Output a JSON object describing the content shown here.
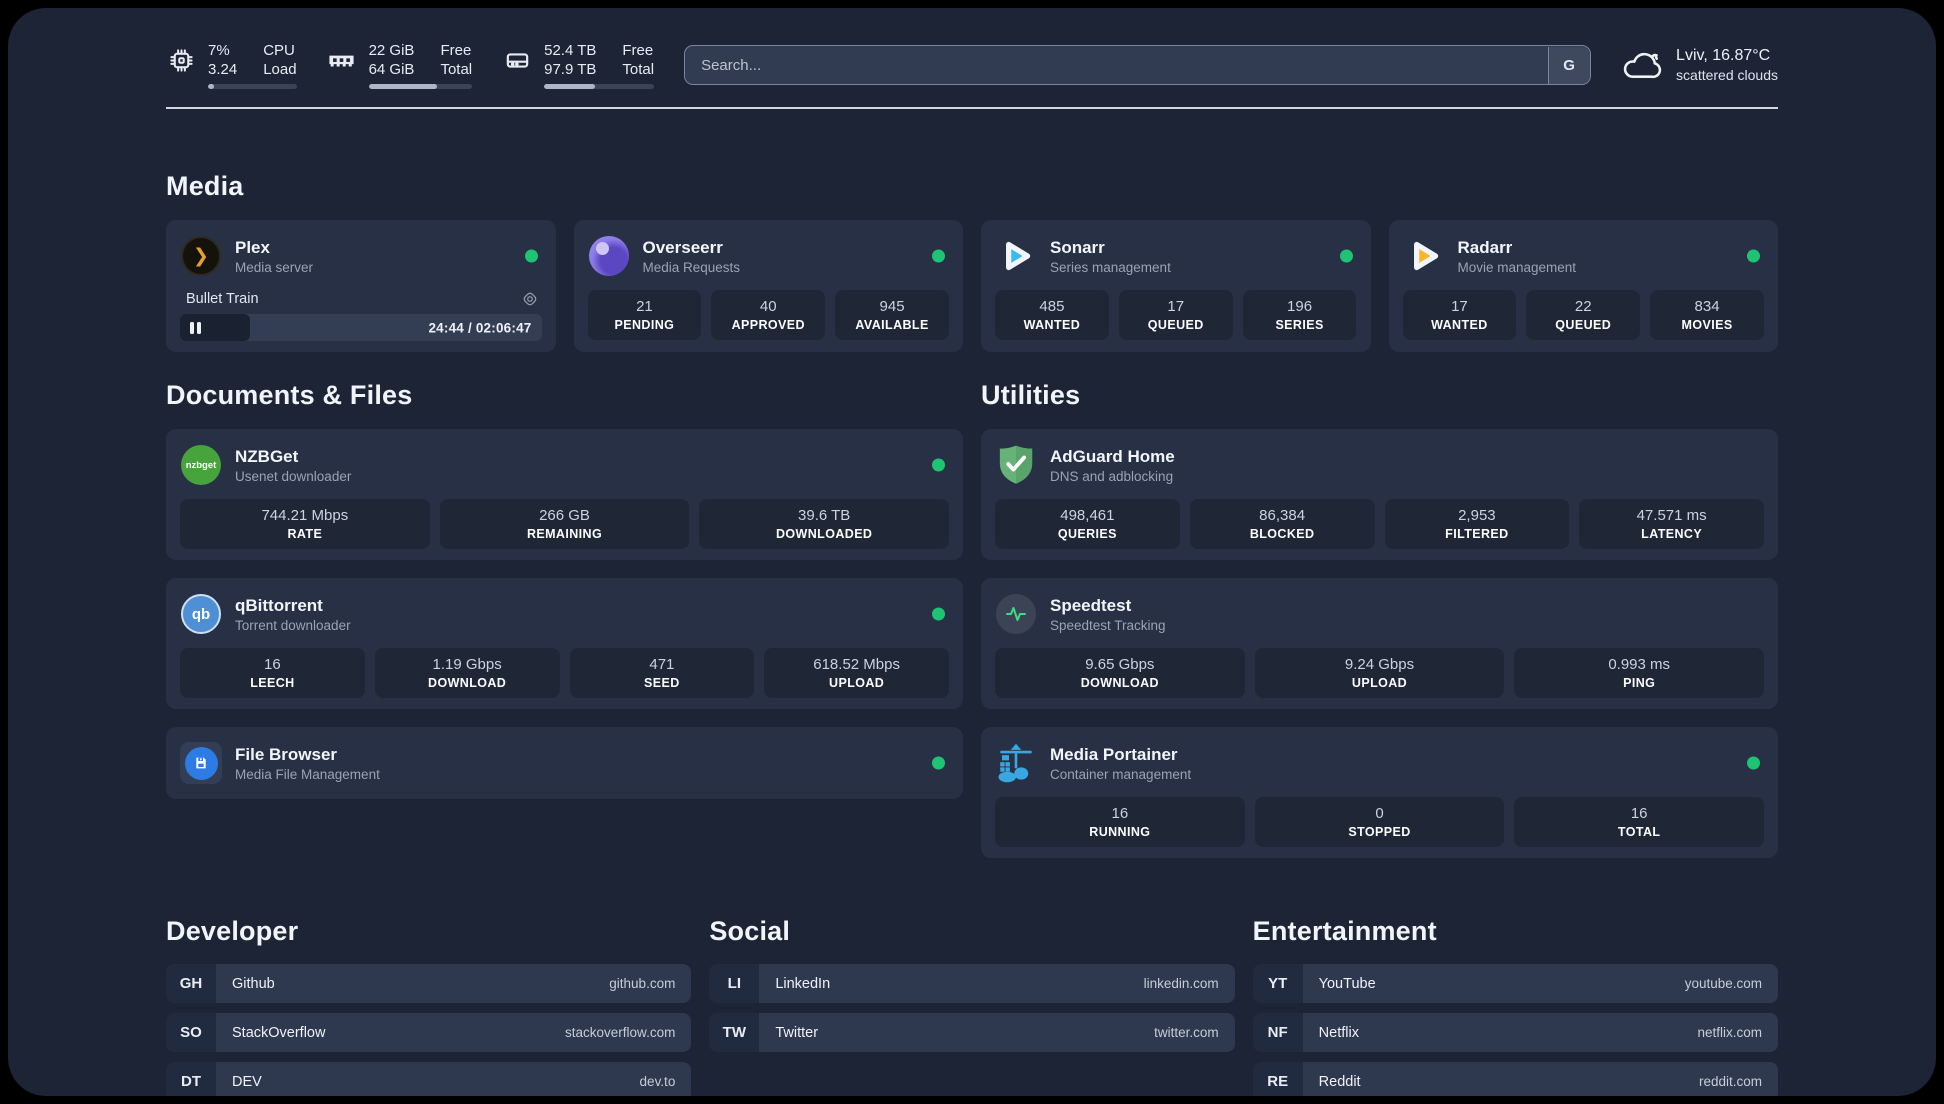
{
  "topbar": {
    "cpu": {
      "value_top": "7%",
      "value_bottom": "3.24",
      "label_top": "CPU",
      "label_bottom": "Load",
      "progress": 7
    },
    "ram": {
      "value_top": "22 GiB",
      "value_bottom": "64 GiB",
      "label_top": "Free",
      "label_bottom": "Total",
      "progress": 66
    },
    "disk": {
      "value_top": "52.4 TB",
      "value_bottom": "97.9 TB",
      "label_top": "Free",
      "label_bottom": "Total",
      "progress": 46
    },
    "search": {
      "placeholder": "Search...",
      "button_label": "G"
    },
    "weather": {
      "title": "Lviv, 16.87°C",
      "subtitle": "scattered clouds"
    }
  },
  "sections": {
    "media": "Media",
    "documents": "Documents & Files",
    "utilities": "Utilities",
    "developer": "Developer",
    "social": "Social",
    "entertainment": "Entertainment"
  },
  "apps": {
    "plex": {
      "name": "Plex",
      "desc": "Media server",
      "icon_glyph": "❯",
      "now_playing": {
        "title": "Bullet Train",
        "time": "24:44 / 02:06:47",
        "progress": 19.5
      }
    },
    "overseerr": {
      "name": "Overseerr",
      "desc": "Media Requests",
      "stats": [
        {
          "value": "21",
          "label": "PENDING"
        },
        {
          "value": "40",
          "label": "APPROVED"
        },
        {
          "value": "945",
          "label": "AVAILABLE"
        }
      ]
    },
    "sonarr": {
      "name": "Sonarr",
      "desc": "Series management",
      "stats": [
        {
          "value": "485",
          "label": "WANTED"
        },
        {
          "value": "17",
          "label": "QUEUED"
        },
        {
          "value": "196",
          "label": "SERIES"
        }
      ]
    },
    "radarr": {
      "name": "Radarr",
      "desc": "Movie management",
      "stats": [
        {
          "value": "17",
          "label": "WANTED"
        },
        {
          "value": "22",
          "label": "QUEUED"
        },
        {
          "value": "834",
          "label": "MOVIES"
        }
      ]
    },
    "nzbget": {
      "name": "NZBGet",
      "desc": "Usenet downloader",
      "icon_text": "nzbget",
      "stats": [
        {
          "value": "744.21 Mbps",
          "label": "RATE"
        },
        {
          "value": "266 GB",
          "label": "REMAINING"
        },
        {
          "value": "39.6 TB",
          "label": "DOWNLOADED"
        }
      ]
    },
    "qbittorrent": {
      "name": "qBittorrent",
      "desc": "Torrent downloader",
      "icon_text": "qb",
      "stats": [
        {
          "value": "16",
          "label": "LEECH"
        },
        {
          "value": "1.19 Gbps",
          "label": "DOWNLOAD"
        },
        {
          "value": "471",
          "label": "SEED"
        },
        {
          "value": "618.52 Mbps",
          "label": "UPLOAD"
        }
      ]
    },
    "filebrowser": {
      "name": "File Browser",
      "desc": "Media File Management"
    },
    "adguard": {
      "name": "AdGuard Home",
      "desc": "DNS and adblocking",
      "stats": [
        {
          "value": "498,461",
          "label": "QUERIES"
        },
        {
          "value": "86,384",
          "label": "BLOCKED"
        },
        {
          "value": "2,953",
          "label": "FILTERED"
        },
        {
          "value": "47.571 ms",
          "label": "LATENCY"
        }
      ]
    },
    "speedtest": {
      "name": "Speedtest",
      "desc": "Speedtest Tracking",
      "stats": [
        {
          "value": "9.65 Gbps",
          "label": "DOWNLOAD"
        },
        {
          "value": "9.24 Gbps",
          "label": "UPLOAD"
        },
        {
          "value": "0.993 ms",
          "label": "PING"
        }
      ]
    },
    "portainer": {
      "name": "Media Portainer",
      "desc": "Container management",
      "stats": [
        {
          "value": "16",
          "label": "RUNNING"
        },
        {
          "value": "0",
          "label": "STOPPED"
        },
        {
          "value": "16",
          "label": "TOTAL"
        }
      ]
    }
  },
  "bookmarks": {
    "developer": [
      {
        "abbr": "GH",
        "name": "Github",
        "url": "github.com"
      },
      {
        "abbr": "SO",
        "name": "StackOverflow",
        "url": "stackoverflow.com"
      },
      {
        "abbr": "DT",
        "name": "DEV",
        "url": "dev.to"
      }
    ],
    "social": [
      {
        "abbr": "LI",
        "name": "LinkedIn",
        "url": "linkedin.com"
      },
      {
        "abbr": "TW",
        "name": "Twitter",
        "url": "twitter.com"
      }
    ],
    "entertainment": [
      {
        "abbr": "YT",
        "name": "YouTube",
        "url": "youtube.com"
      },
      {
        "abbr": "NF",
        "name": "Netflix",
        "url": "netflix.com"
      },
      {
        "abbr": "RE",
        "name": "Reddit",
        "url": "reddit.com"
      }
    ]
  },
  "colors": {
    "status_online": "#1fc374",
    "accent_card": "#273044",
    "page_bg": "#1c2436"
  }
}
